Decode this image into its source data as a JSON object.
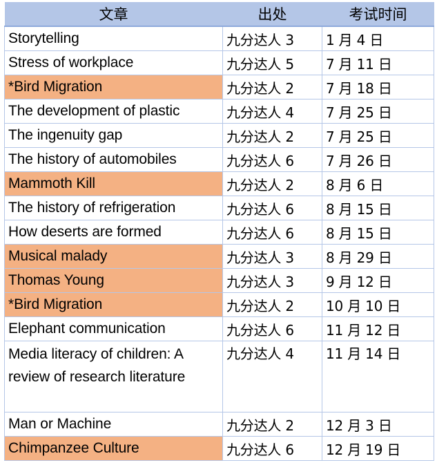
{
  "header": {
    "col_article": "文章",
    "col_source": "出处",
    "col_date": "考试时间"
  },
  "highlight_color": "#F4B183",
  "header_color": "#B4C6E7",
  "rows": [
    {
      "title": "Storytelling",
      "source": "九分达人 3",
      "date": "1 月 4 日",
      "highlighted": false
    },
    {
      "title": "Stress of workplace",
      "source": "九分达人 5",
      "date": "7 月 11 日",
      "highlighted": false
    },
    {
      "title": "*Bird Migration",
      "source": "九分达人 2",
      "date": "7 月 18 日",
      "highlighted": true
    },
    {
      "title": "The development of plastic",
      "source": "九分达人 4",
      "date": "7 月 25 日",
      "highlighted": false
    },
    {
      "title": "The ingenuity gap",
      "source": "九分达人 2",
      "date": "7 月 25 日",
      "highlighted": false
    },
    {
      "title": "The history of automobiles",
      "source": "九分达人 6",
      "date": "7 月 26 日",
      "highlighted": false
    },
    {
      "title": "Mammoth Kill",
      "source": "九分达人 2",
      "date": "8 月 6 日",
      "highlighted": true
    },
    {
      "title": "The history of refrigeration",
      "source": "九分达人 6",
      "date": "8 月 15 日",
      "highlighted": false
    },
    {
      "title": "How deserts are formed",
      "source": "九分达人 6",
      "date": "8 月 15 日",
      "highlighted": false
    },
    {
      "title": "Musical malady",
      "source": "九分达人 3",
      "date": "8 月 29 日",
      "highlighted": true
    },
    {
      "title": "Thomas Young",
      "source": "九分达人 3",
      "date": "9 月 12 日",
      "highlighted": true
    },
    {
      "title": "*Bird Migration",
      "source": "九分达人 2",
      "date": "10 月 10 日",
      "highlighted": true
    },
    {
      "title": "Elephant communication",
      "source": "九分达人 6",
      "date": "11 月 12 日",
      "highlighted": false
    },
    {
      "title": "Media literacy of children: A review of research literature",
      "source": "九分达人 4",
      "date": "11 月 14 日",
      "highlighted": false,
      "multiline": true
    },
    {
      "title": "Man or Machine",
      "source": "九分达人 2",
      "date": "12 月 3 日",
      "highlighted": false
    },
    {
      "title": "Chimpanzee Culture",
      "source": "九分达人 6",
      "date": "12 月 19 日",
      "highlighted": true
    }
  ]
}
